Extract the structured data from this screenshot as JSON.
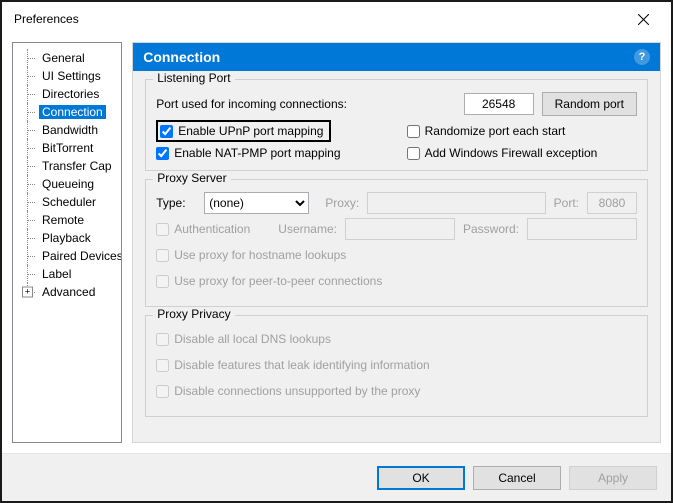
{
  "window": {
    "title": "Preferences"
  },
  "sidebar": {
    "items": [
      {
        "label": "General"
      },
      {
        "label": "UI Settings"
      },
      {
        "label": "Directories"
      },
      {
        "label": "Connection",
        "selected": true
      },
      {
        "label": "Bandwidth"
      },
      {
        "label": "BitTorrent"
      },
      {
        "label": "Transfer Cap"
      },
      {
        "label": "Queueing"
      },
      {
        "label": "Scheduler"
      },
      {
        "label": "Remote"
      },
      {
        "label": "Playback"
      },
      {
        "label": "Paired Devices"
      },
      {
        "label": "Label"
      },
      {
        "label": "Advanced",
        "expandable": true
      }
    ]
  },
  "panel": {
    "title": "Connection",
    "help": "?"
  },
  "listening": {
    "group_title": "Listening Port",
    "port_label": "Port used for incoming connections:",
    "port_value": "26548",
    "random_btn": "Random port",
    "upnp": "Enable UPnP port mapping",
    "natpmp": "Enable NAT-PMP port mapping",
    "randomize": "Randomize port each start",
    "firewall": "Add Windows Firewall exception"
  },
  "proxy": {
    "group_title": "Proxy Server",
    "type_label": "Type:",
    "type_value": "(none)",
    "proxy_label": "Proxy:",
    "port_label": "Port:",
    "port_value": "8080",
    "auth": "Authentication",
    "user_label": "Username:",
    "pass_label": "Password:",
    "hostname": "Use proxy for hostname lookups",
    "p2p": "Use proxy for peer-to-peer connections"
  },
  "privacy": {
    "group_title": "Proxy Privacy",
    "dns": "Disable all local DNS lookups",
    "leak": "Disable features that leak identifying information",
    "unsupported": "Disable connections unsupported by the proxy"
  },
  "footer": {
    "ok": "OK",
    "cancel": "Cancel",
    "apply": "Apply"
  }
}
